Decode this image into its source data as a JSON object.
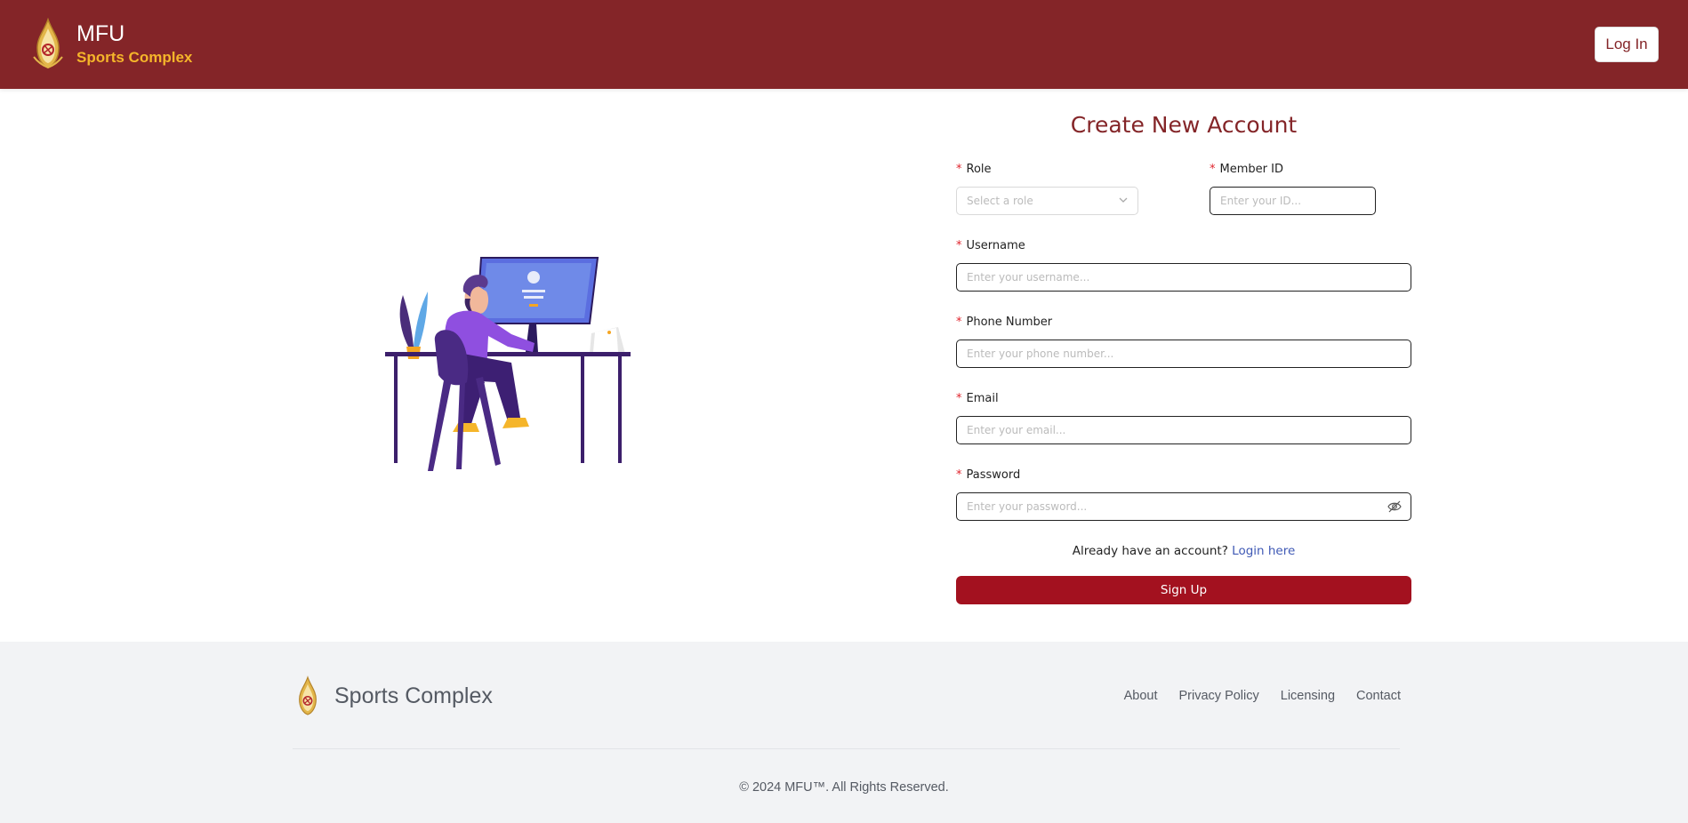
{
  "header": {
    "title": "MFU",
    "subtitle": "Sports Complex",
    "login_label": "Log In"
  },
  "form": {
    "title": "Create New Account",
    "fields": {
      "role": {
        "label": "Role",
        "placeholder": "Select a role"
      },
      "member_id": {
        "label": "Member ID",
        "placeholder": "Enter your ID..."
      },
      "username": {
        "label": "Username",
        "placeholder": "Enter your username..."
      },
      "phone": {
        "label": "Phone Number",
        "placeholder": "Enter your phone number..."
      },
      "email": {
        "label": "Email",
        "placeholder": "Enter your email..."
      },
      "password": {
        "label": "Password",
        "placeholder": "Enter your password..."
      }
    },
    "required_mark": "*",
    "already_text": "Already have an account?",
    "login_link": "Login here",
    "signup_label": "Sign Up"
  },
  "footer": {
    "brand": "Sports Complex",
    "links": [
      "About",
      "Privacy Policy",
      "Licensing",
      "Contact"
    ],
    "copyright": "© 2024 MFU™. All Rights Reserved."
  },
  "colors": {
    "header_bg": "#842528",
    "accent": "#f5b52a",
    "primary_button": "#a3111f",
    "link": "#3f59b5",
    "footer_bg": "#f2f3f5"
  },
  "icons": {
    "logo": "mfu-emblem-icon",
    "role_dropdown": "chevron-down-icon",
    "password_toggle": "eye-off-icon"
  }
}
